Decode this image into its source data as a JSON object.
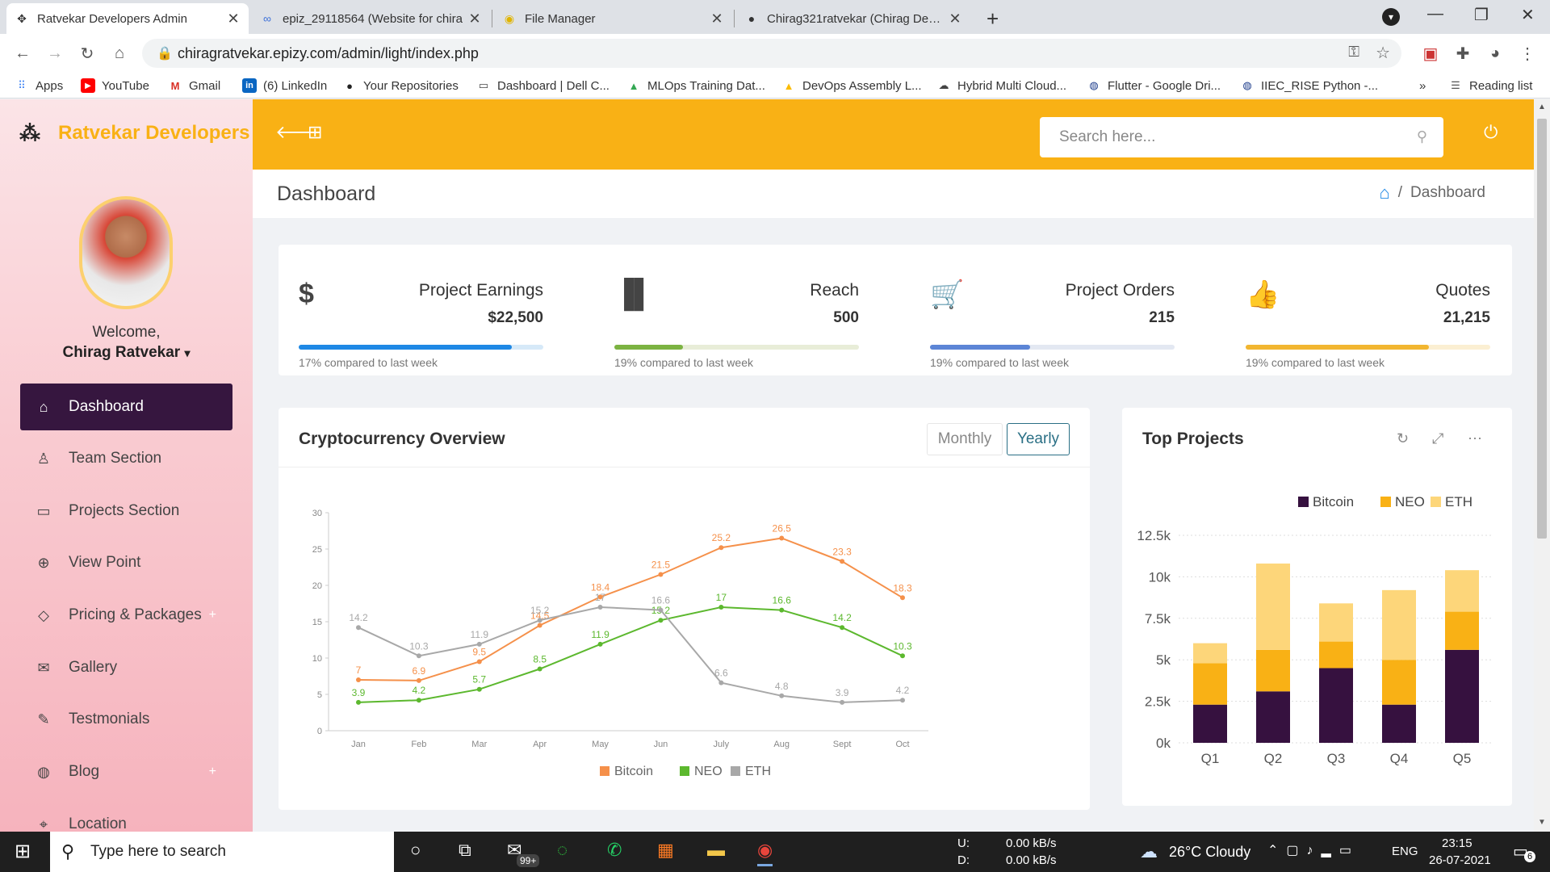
{
  "browser": {
    "tabs": [
      {
        "title": "Ratvekar Developers Admin",
        "icon": "grid-icon"
      },
      {
        "title": "epiz_29118564 (Website for chira",
        "icon": "infinity-icon"
      },
      {
        "title": "File Manager",
        "icon": "file-manager-icon"
      },
      {
        "title": "Chirag321ratvekar (Chirag Deepa",
        "icon": "github-icon"
      }
    ],
    "url": "chiragratvekar.epizy.com/admin/light/index.php",
    "bookmarks": [
      {
        "label": "Apps"
      },
      {
        "label": "YouTube"
      },
      {
        "label": "Gmail"
      },
      {
        "label": "(6) LinkedIn"
      },
      {
        "label": "Your Repositories"
      },
      {
        "label": "Dashboard | Dell C..."
      },
      {
        "label": "MLOps Training Dat..."
      },
      {
        "label": "DevOps Assembly L..."
      },
      {
        "label": "Hybrid Multi Cloud..."
      },
      {
        "label": "Flutter - Google Dri..."
      },
      {
        "label": "IIEC_RISE Python -..."
      }
    ],
    "overflow": "»",
    "reading_list": "Reading list"
  },
  "sidebar": {
    "brand": "Ratvekar Developers",
    "welcome": "Welcome,",
    "user": "Chirag Ratvekar",
    "items": [
      {
        "label": "Dashboard",
        "icon": "home-icon"
      },
      {
        "label": "Team Section",
        "icon": "user-icon"
      },
      {
        "label": "Projects Section",
        "icon": "monitor-icon"
      },
      {
        "label": "View Point",
        "icon": "crosshair-icon"
      },
      {
        "label": "Pricing & Packages",
        "icon": "diamond-icon"
      },
      {
        "label": "Gallery",
        "icon": "mail-icon"
      },
      {
        "label": "Testmonials",
        "icon": "pencil-icon"
      },
      {
        "label": "Blog",
        "icon": "globe-icon"
      },
      {
        "label": "Location",
        "icon": "map-icon"
      }
    ],
    "plus": "+"
  },
  "header": {
    "search_placeholder": "Search here..."
  },
  "page": {
    "title": "Dashboard",
    "breadcrumb": "Dashboard",
    "sep": "/"
  },
  "stats": [
    {
      "label": "Project Earnings",
      "value": "$22,500",
      "compare": "17% compared to last week",
      "progress": 0.87,
      "color": "#1e88e5",
      "track": "#d6e9f8",
      "icon": "dollar-icon"
    },
    {
      "label": "Reach",
      "value": "500",
      "compare": "19% compared to last week",
      "progress": 0.28,
      "color": "#7cb342",
      "track": "#e8edd8",
      "icon": "bar-chart-icon"
    },
    {
      "label": "Project Orders",
      "value": "215",
      "compare": "19% compared to last week",
      "progress": 0.41,
      "color": "#5c85d6",
      "track": "#e3e8f2",
      "icon": "cart-icon"
    },
    {
      "label": "Quotes",
      "value": "21,215",
      "compare": "19% compared to last week",
      "progress": 0.75,
      "color": "#f2b630",
      "track": "#fbefd2",
      "icon": "thumbs-up-icon"
    }
  ],
  "crypto": {
    "title": "Cryptocurrency Overview",
    "toggle": [
      "Monthly",
      "Yearly"
    ]
  },
  "projects": {
    "title": "Top Projects"
  },
  "colors": {
    "accent": "#f9b115",
    "sidebar_active": "#36163f"
  },
  "chart_data": [
    {
      "type": "line",
      "categories": [
        "Jan",
        "Feb",
        "Mar",
        "Apr",
        "May",
        "Jun",
        "July",
        "Aug",
        "Sept",
        "Oct"
      ],
      "ylim": [
        0,
        30
      ],
      "yticks": [
        0,
        5,
        10,
        15,
        20,
        25,
        30
      ],
      "series": [
        {
          "name": "Bitcoin",
          "color": "#f5904a",
          "values": [
            7,
            6.9,
            9.5,
            14.5,
            18.4,
            21.5,
            25.2,
            26.5,
            23.3,
            18.3
          ]
        },
        {
          "name": "NEO",
          "color": "#5cb82e",
          "values": [
            3.9,
            4.2,
            5.7,
            8.5,
            11.9,
            15.2,
            17,
            16.6,
            14.2,
            10.3
          ]
        },
        {
          "name": "ETH",
          "color": "#a8a8a8",
          "values": [
            14.2,
            10.3,
            11.9,
            15.2,
            17,
            16.6,
            6.6,
            4.8,
            3.9,
            4.2
          ]
        }
      ],
      "legend": "bottom",
      "grid": false
    },
    {
      "type": "bar",
      "stacked": true,
      "categories": [
        "Q1",
        "Q2",
        "Q3",
        "Q4",
        "Q5"
      ],
      "ylim": [
        0,
        12500
      ],
      "yticks": [
        "0k",
        "2.5k",
        "5k",
        "7.5k",
        "10k",
        "12.5k"
      ],
      "series": [
        {
          "name": "Bitcoin",
          "color": "#36113f",
          "values": [
            2300,
            3100,
            4500,
            2300,
            5600
          ]
        },
        {
          "name": "NEO",
          "color": "#f9b115",
          "values": [
            2500,
            2500,
            1600,
            2700,
            2300
          ]
        },
        {
          "name": "ETH",
          "color": "#fdd67a",
          "values": [
            1200,
            5200,
            2300,
            4200,
            2500
          ]
        }
      ],
      "legend": "top",
      "grid": true
    }
  ],
  "taskbar": {
    "search": "Type here to search",
    "badge": "99+",
    "net_up_label": "U:",
    "net_down_label": "D:",
    "net_up": "0.00 kB/s",
    "net_down": "0.00 kB/s",
    "weather": "26°C  Cloudy",
    "lang": "ENG",
    "time": "23:15",
    "date": "26-07-2021",
    "notif": "6"
  }
}
